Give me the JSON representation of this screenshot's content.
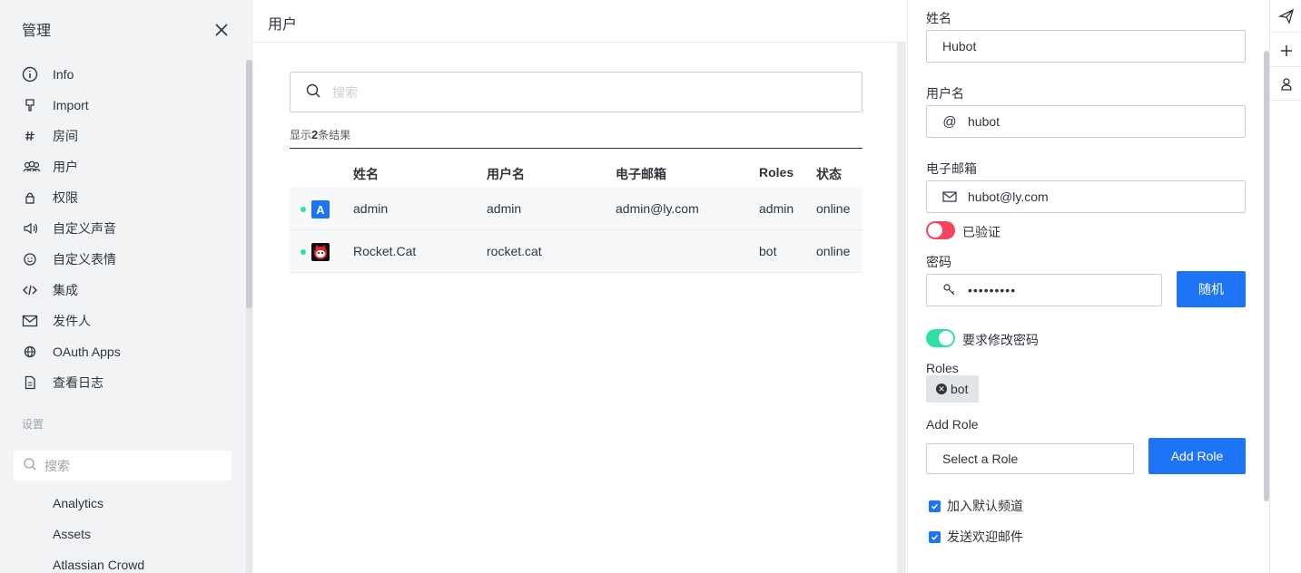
{
  "sidebar": {
    "title": "管理",
    "items": [
      {
        "label": "Info",
        "icon": "info-icon"
      },
      {
        "label": "Import",
        "icon": "import-icon"
      },
      {
        "label": "房间",
        "icon": "hashtag-icon"
      },
      {
        "label": "用户",
        "icon": "team-icon"
      },
      {
        "label": "权限",
        "icon": "lock-icon"
      },
      {
        "label": "自定义声音",
        "icon": "volume-icon"
      },
      {
        "label": "自定义表情",
        "icon": "emoji-icon"
      },
      {
        "label": "集成",
        "icon": "code-icon"
      },
      {
        "label": "发件人",
        "icon": "mail-icon"
      },
      {
        "label": "OAuth Apps",
        "icon": "globe-icon"
      },
      {
        "label": "查看日志",
        "icon": "document-icon"
      }
    ],
    "settings_title": "设置",
    "search_placeholder": "搜索",
    "settings_items": [
      "Analytics",
      "Assets",
      "Atlassian Crowd"
    ]
  },
  "main": {
    "title": "用户",
    "search_placeholder": "搜索",
    "result_prefix": "显示",
    "result_count": "2",
    "result_suffix": "条结果",
    "columns": [
      "姓名",
      "用户名",
      "电子邮箱",
      "Roles",
      "状态"
    ],
    "rows": [
      {
        "name": "admin",
        "username": "admin",
        "email": "admin@ly.com",
        "roles": "admin",
        "status": "online",
        "avatar_letter": "A",
        "avatar_color": "#1d74f5"
      },
      {
        "name": "Rocket.Cat",
        "username": "rocket.cat",
        "email": "",
        "roles": "bot",
        "status": "online",
        "avatar_letter": "",
        "avatar_color": "#111111"
      }
    ],
    "status_color": "#2de0a5"
  },
  "panel": {
    "name_label": "姓名",
    "name_value": "Hubot",
    "username_label": "用户名",
    "username_value": "hubot",
    "email_label": "电子邮箱",
    "email_value": "hubot@ly.com",
    "verified_label": "已验证",
    "verified_on": false,
    "verified_color": "#f5455c",
    "password_label": "密码",
    "password_value": "•••••••••",
    "random_button": "随机",
    "require_change_label": "要求修改密码",
    "require_change_on": true,
    "require_change_color": "#2de0a5",
    "roles_label": "Roles",
    "roles": [
      "bot"
    ],
    "add_role_label": "Add Role",
    "select_role_placeholder": "Select a Role",
    "add_role_button": "Add Role",
    "join_default_label": "加入默认频道",
    "send_welcome_label": "发送欢迎邮件",
    "accent_color": "#1d74f5"
  },
  "strip": {
    "icons": [
      "send-icon",
      "plus-icon",
      "user-icon"
    ]
  }
}
